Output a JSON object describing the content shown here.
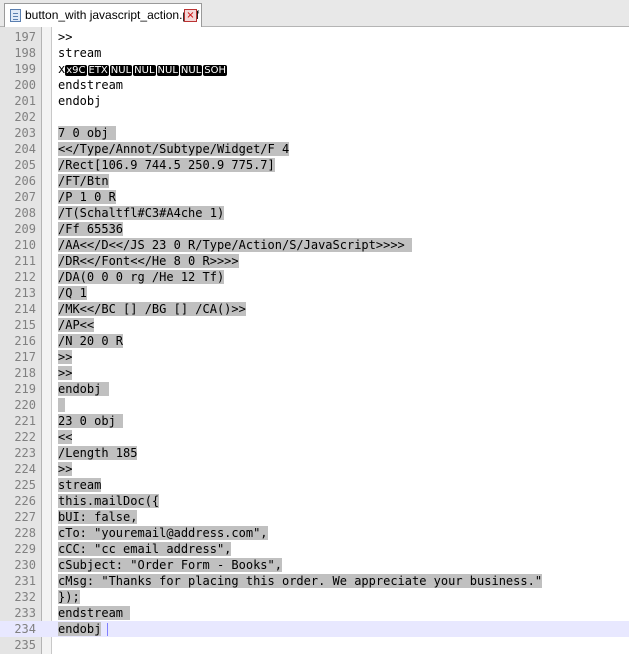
{
  "tab": {
    "title": "button_with javascript_action.pdf",
    "close_label": "×",
    "file_icon": "document-icon",
    "close_icon": "close-icon"
  },
  "colors": {
    "selection": "#c0c0c0",
    "current_line": "#e8e8ff",
    "gutter": "#e4e4e4",
    "line_number": "#808080"
  },
  "editor": {
    "lines": [
      {
        "n": "197",
        "text": ">>"
      },
      {
        "n": "198",
        "text": "stream"
      },
      {
        "n": "199",
        "prefix": "x",
        "controls": [
          "x9C",
          "ETX",
          "NUL",
          "NUL",
          "NUL",
          "NUL",
          "SOH"
        ]
      },
      {
        "n": "200",
        "text": "endstream"
      },
      {
        "n": "201",
        "text": "endobj"
      },
      {
        "n": "202",
        "text": ""
      },
      {
        "n": "203",
        "text": "7 0 obj ",
        "selected": true
      },
      {
        "n": "204",
        "text": "<</Type/Annot/Subtype/Widget/F 4",
        "selected": true
      },
      {
        "n": "205",
        "text": "/Rect[106.9 744.5 250.9 775.7]",
        "selected": true
      },
      {
        "n": "206",
        "text": "/FT/Btn",
        "selected": true
      },
      {
        "n": "207",
        "text": "/P 1 0 R",
        "selected": true
      },
      {
        "n": "208",
        "text": "/T(Schaltfl#C3#A4che 1)",
        "selected": true
      },
      {
        "n": "209",
        "text": "/Ff 65536",
        "selected": true
      },
      {
        "n": "210",
        "text": "/AA<</D<</JS 23 0 R/Type/Action/S/JavaScript>>>> ",
        "selected": true
      },
      {
        "n": "211",
        "text": "/DR<</Font<</He 8 0 R>>>>",
        "selected": true
      },
      {
        "n": "212",
        "text": "/DA(0 0 0 rg /He 12 Tf)",
        "selected": true
      },
      {
        "n": "213",
        "text": "/Q 1",
        "selected": true
      },
      {
        "n": "214",
        "text": "/MK<</BC [] /BG [] /CA()>>",
        "selected": true
      },
      {
        "n": "215",
        "text": "/AP<<",
        "selected": true
      },
      {
        "n": "216",
        "text": "/N 20 0 R",
        "selected": true
      },
      {
        "n": "217",
        "text": ">>",
        "selected": true
      },
      {
        "n": "218",
        "text": ">>",
        "selected": true
      },
      {
        "n": "219",
        "text": "endobj ",
        "selected": true
      },
      {
        "n": "220",
        "text": " ",
        "selected": true
      },
      {
        "n": "221",
        "text": "23 0 obj ",
        "selected": true
      },
      {
        "n": "222",
        "text": "<<",
        "selected": true
      },
      {
        "n": "223",
        "text": "/Length 185",
        "selected": true
      },
      {
        "n": "224",
        "text": ">>",
        "selected": true
      },
      {
        "n": "225",
        "text": "stream",
        "selected": true
      },
      {
        "n": "226",
        "text": "this.mailDoc({",
        "selected": true
      },
      {
        "n": "227",
        "text": "bUI: false,",
        "selected": true
      },
      {
        "n": "228",
        "text": "cTo: \"youremail@address.com\",",
        "selected": true
      },
      {
        "n": "229",
        "text": "cCC: \"cc email address\",",
        "selected": true
      },
      {
        "n": "230",
        "text": "cSubject: \"Order Form - Books\",",
        "selected": true
      },
      {
        "n": "231",
        "text": "cMsg: \"Thanks for placing this order. We appreciate your business.\"",
        "selected": true
      },
      {
        "n": "232",
        "text": "});",
        "selected": true
      },
      {
        "n": "233",
        "text": "endstream ",
        "selected": true
      },
      {
        "n": "234",
        "text": "endobj",
        "selected": true,
        "current": true,
        "caret": true
      },
      {
        "n": "235",
        "text": ""
      }
    ]
  }
}
